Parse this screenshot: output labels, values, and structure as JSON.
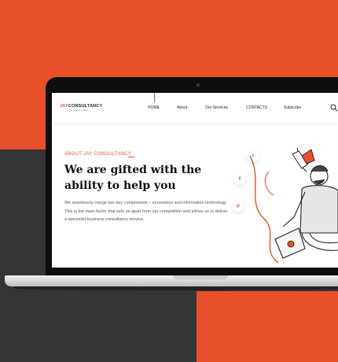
{
  "nav": {
    "logo_part1": "JAY",
    "logo_part2": "CONSULTANCY",
    "logo_tagline": "your business partner",
    "items": [
      {
        "label": "HOME"
      },
      {
        "label": "About"
      },
      {
        "label": "Our Services"
      },
      {
        "label": "CONTACTS"
      },
      {
        "label": "Subscribe"
      }
    ],
    "search_icon": "search-icon"
  },
  "hero": {
    "eyebrow": "ABOUT JAY CONSULTANCY",
    "headline_line1": "We are gifted with the",
    "headline_line2": "ability to help you",
    "body": "We seamlessly merge two key components – economics and information technology. This is the main factor that sets us apart from our competition and allows us to deliver a specialist business consultancy service."
  },
  "social": [
    {
      "icon": "twitter-icon",
      "glyph": "t"
    },
    {
      "icon": "facebook-icon",
      "glyph": "f"
    },
    {
      "icon": "pinterest-icon",
      "glyph": "p"
    }
  ],
  "colors": {
    "accent": "#e8502a",
    "dark_bg": "#353535",
    "text_dark": "#111111",
    "text_body": "#555555"
  }
}
